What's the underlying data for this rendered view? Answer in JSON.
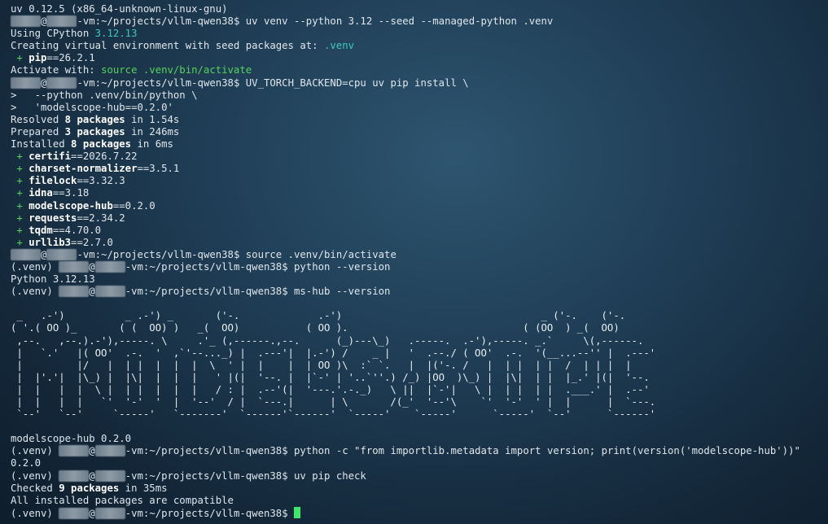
{
  "lines": {
    "l1": "uv 0.12.5 (x86_64-unknown-linux-gnu)",
    "user_masked": "xxxxx",
    "host_masked": "xxxxx",
    "prompt_path": "-vm:~/projects/vllm-qwen38$ ",
    "cmd_venv": "uv venv --python 3.12 --seed --managed-python .venv",
    "using_label": "Using CPython ",
    "using_ver": "3.12.13",
    "creating": "Creating virtual environment with seed packages at: ",
    "creating_path": ".venv",
    "pip_pkg": "pip",
    "pip_ver": "==26.2.1",
    "activate_label": "Activate with: ",
    "activate_cmd": "source .venv/bin/activate",
    "cmd_install": "UV_TORCH_BACKEND=cpu uv pip install \\",
    "cont1": ">   --python .venv/bin/python \\",
    "cont2": ">   'modelscope-hub==0.2.0'",
    "resolved_a": "Resolved ",
    "resolved_b": "8 packages",
    "resolved_c": " in 1.54s",
    "prepared_a": "Prepared ",
    "prepared_b": "3 packages",
    "prepared_c": " in 246ms",
    "installed_a": "Installed ",
    "installed_b": "8 packages",
    "installed_c": " in 6ms",
    "cmd_source": "source .venv/bin/activate",
    "venv_prefix": "(.venv) ",
    "at": "@",
    "cmd_pyver": "python --version",
    "python_out": "Python 3.12.13",
    "cmd_mshub": "ms-hub --version",
    "mshub_out": "modelscope-hub 0.2.0",
    "cmd_pyc": "python -c \"from importlib.metadata import version; print(version('modelscope-hub'))\"",
    "pyc_out": "0.2.0",
    "cmd_check": "uv pip check",
    "checked_a": "Checked ",
    "checked_b": "9 packages",
    "checked_c": " in 35ms",
    "compatible": "All installed packages are compatible"
  },
  "packages": [
    {
      "name": "certifi",
      "ver": "==2026.7.22"
    },
    {
      "name": "charset-normalizer",
      "ver": "==3.5.1"
    },
    {
      "name": "filelock",
      "ver": "==3.32.3"
    },
    {
      "name": "idna",
      "ver": "==3.18"
    },
    {
      "name": "modelscope-hub",
      "ver": "==0.2.0"
    },
    {
      "name": "requests",
      "ver": "==2.34.2"
    },
    {
      "name": "tqdm",
      "ver": "==4.70.0"
    },
    {
      "name": "urllib3",
      "ver": "==2.7.0"
    }
  ],
  "plus_sign": " + ",
  "banner": [
    " _   .-')          _ .-') _       ('-.             .-')                                 _ ('-.    ('-.",
    "( '.( OO )_       ( (  OO) )   _(  OO)           ( OO ).                             ( (OO  ) _(  OO)",
    " ,--.   ,--.).-'),-----. \\     .'_ (,------.,--.      (_)---\\_)   .-----.  .-'),-----. _.`     \\(,------.",
    " |   `.'   |( OO'  .-.  '  ,`'--..._) |  .---'|  |.-') /    _ |   '  .--./ ( OO'  .-.  '(__...--'' |  .---'",
    " |         |/   |  | |  |  |  |  \\  ' |  |    |  | OO )\\  :` `.   |  |('-. /   |  | |  | |  /  | | |  |",
    " |  |'.'|  |\\_) |  |\\|  |  |  |   ' |(|  '--. |  |`-' | '..`''.) /_) |OO  )\\_) |  |\\|  | |  |_.' |(|  '--.",
    " |  |   |  |  \\ |  | |  |  |  |   / : |  .--'(|  '---.'.-._)   \\ ||  |`-'|   \\ |  | |  | |  .___.' |  .--'",
    " |  |   |  |   `'  '-'  '  |  '--'  / |  `---.|      | \\       /(_'  '--'\\    `'  '-'  ' |  |      |  `---.",
    " `--'   `--'     `-----'   `-------'  `------'`------'  `-----'    `-----'      `-----'  `--'      `------'"
  ]
}
